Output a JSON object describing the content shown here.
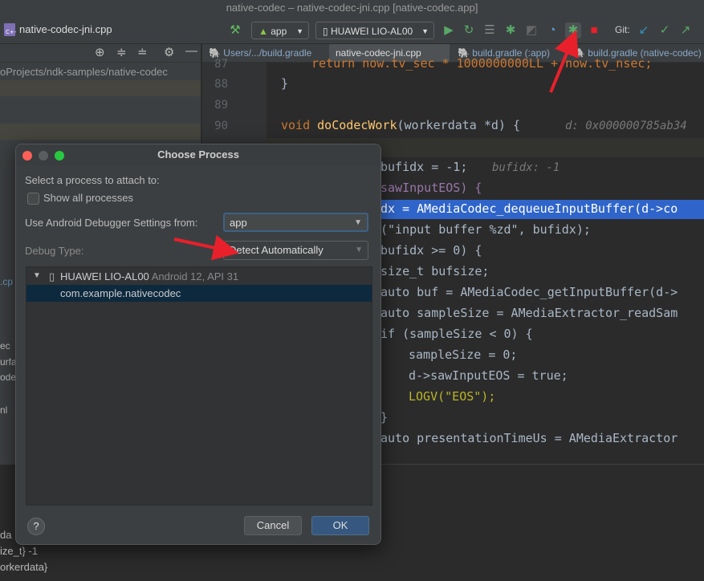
{
  "window": {
    "title": "native-codec – native-codec-jni.cpp [native-codec.app]"
  },
  "toolbar": {
    "file_label": "native-codec-jni.cpp",
    "config_label": "app",
    "device_label": "HUAWEI LIO-AL00",
    "git_label": "Git:"
  },
  "project": {
    "path": "oProjects/ndk-samples/native-codec"
  },
  "tabs": [
    {
      "label": "Users/.../build.gradle"
    },
    {
      "label": "native-codec-jni.cpp"
    },
    {
      "label": "build.gradle (:app)"
    },
    {
      "label": "build.gradle (native-codec)"
    }
  ],
  "editor": {
    "line_numbers": [
      "87",
      "88",
      "89",
      "90"
    ],
    "lines": {
      "l87": "return now.tv_sec * 1000000000LL + now.tv_nsec;",
      "l88": "}",
      "l90_kw": "void ",
      "l90_fn": "doCodecWork",
      "l90_rest": "(workerdata *d) {",
      "l90_hint": "d: 0x000000785ab34",
      "l92": "bufidx = -1;",
      "l92_hint": "bufidx: -1",
      "l93": "sawInputEOS) {",
      "l94": "dx = AMediaCodec_dequeueInputBuffer(d->co",
      "l95": "(\"input buffer %zd\", bufidx);",
      "l96": "bufidx >= 0) {",
      "l97": "size_t bufsize;",
      "l98": "auto buf = AMediaCodec_getInputBuffer(d->",
      "l99": "auto sampleSize = AMediaExtractor_readSam",
      "l100": "if (sampleSize < 0) {",
      "l101": "sampleSize = 0;",
      "l102": "d->sawInputEOS = true;",
      "l103": "LOGV(\"EOS\");",
      "l104": "}",
      "l105": "auto presentationTimeUs = AMediaExtractor"
    }
  },
  "left_fragments": [
    ".cp",
    "ec",
    "urfa",
    "ode",
    "nl"
  ],
  "bottom_fragments": [
    "da",
    "ize_t} -1",
    "orkerdata}"
  ],
  "dialog": {
    "title": "Choose Process",
    "select_label": "Select a process to attach to:",
    "show_all_label": "Show all processes",
    "settings_label": "Use Android Debugger Settings from:",
    "settings_value": "app",
    "debug_type_label": "Debug Type:",
    "debug_type_value": "Detect Automatically",
    "device_name": "HUAWEI LIO-AL00",
    "device_info": "Android 12, API 31",
    "process_name": "com.example.nativecodec",
    "help_label": "?",
    "cancel_label": "Cancel",
    "ok_label": "OK"
  },
  "colors": {
    "accent_red": "#e8202b",
    "selection_blue": "#2f65ca",
    "ok_blue": "#365880"
  },
  "icons": [
    "android-icon",
    "hammer-icon",
    "run-icon",
    "apply-changes-icon",
    "debug-icon",
    "profile-icon",
    "attach-debugger-icon",
    "stop-icon",
    "coverage-icon",
    "git-update-icon",
    "git-commit-icon",
    "git-push-icon",
    "target-icon",
    "collapse-icon",
    "expand-icon",
    "gear-icon",
    "minimize-icon",
    "phone-icon",
    "chevron-down-icon"
  ]
}
